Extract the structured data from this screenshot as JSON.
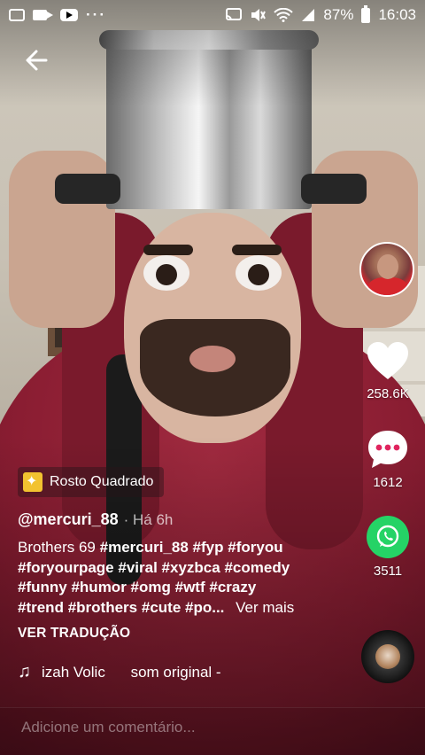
{
  "status_bar": {
    "left_icons": [
      "gallery-icon",
      "video-icon",
      "youtube-icon"
    ],
    "overflow": "···",
    "right_icons": [
      "cast-icon",
      "mute-icon",
      "wifi-icon",
      "signal-icon"
    ],
    "battery": "87%",
    "time": "16:03"
  },
  "nav": {
    "back_icon": "arrow-left-icon"
  },
  "side_actions": {
    "like_count": "258.6K",
    "comment_count": "1612",
    "share_count": "3511"
  },
  "effect": {
    "label": "Rosto Quadrado"
  },
  "post": {
    "username": "@mercuri_88",
    "time_ago": "· Há 6h",
    "caption_lead": "Brothers 69",
    "hashtags_line1": [
      "#mercuri_88",
      "#fyp",
      "#foryou"
    ],
    "hashtags_line2": [
      "#foryourpage",
      "#viral",
      "#xyzbca",
      "#comedy"
    ],
    "hashtags_line3": [
      "#funny",
      "#humor",
      "#omg",
      "#wtf",
      "#crazy"
    ],
    "hashtags_line4": [
      "#trend",
      "#brothers",
      "#cute",
      "#po..."
    ],
    "see_more": "Ver mais",
    "translate": "VER TRADUÇÃO"
  },
  "music": {
    "artist_fragment": "izah Volic",
    "sound": "som original -"
  },
  "comment": {
    "placeholder": "Adicione um comentário..."
  },
  "colors": {
    "whatsapp": "#25d366",
    "hoodie": "#8c1f33"
  }
}
